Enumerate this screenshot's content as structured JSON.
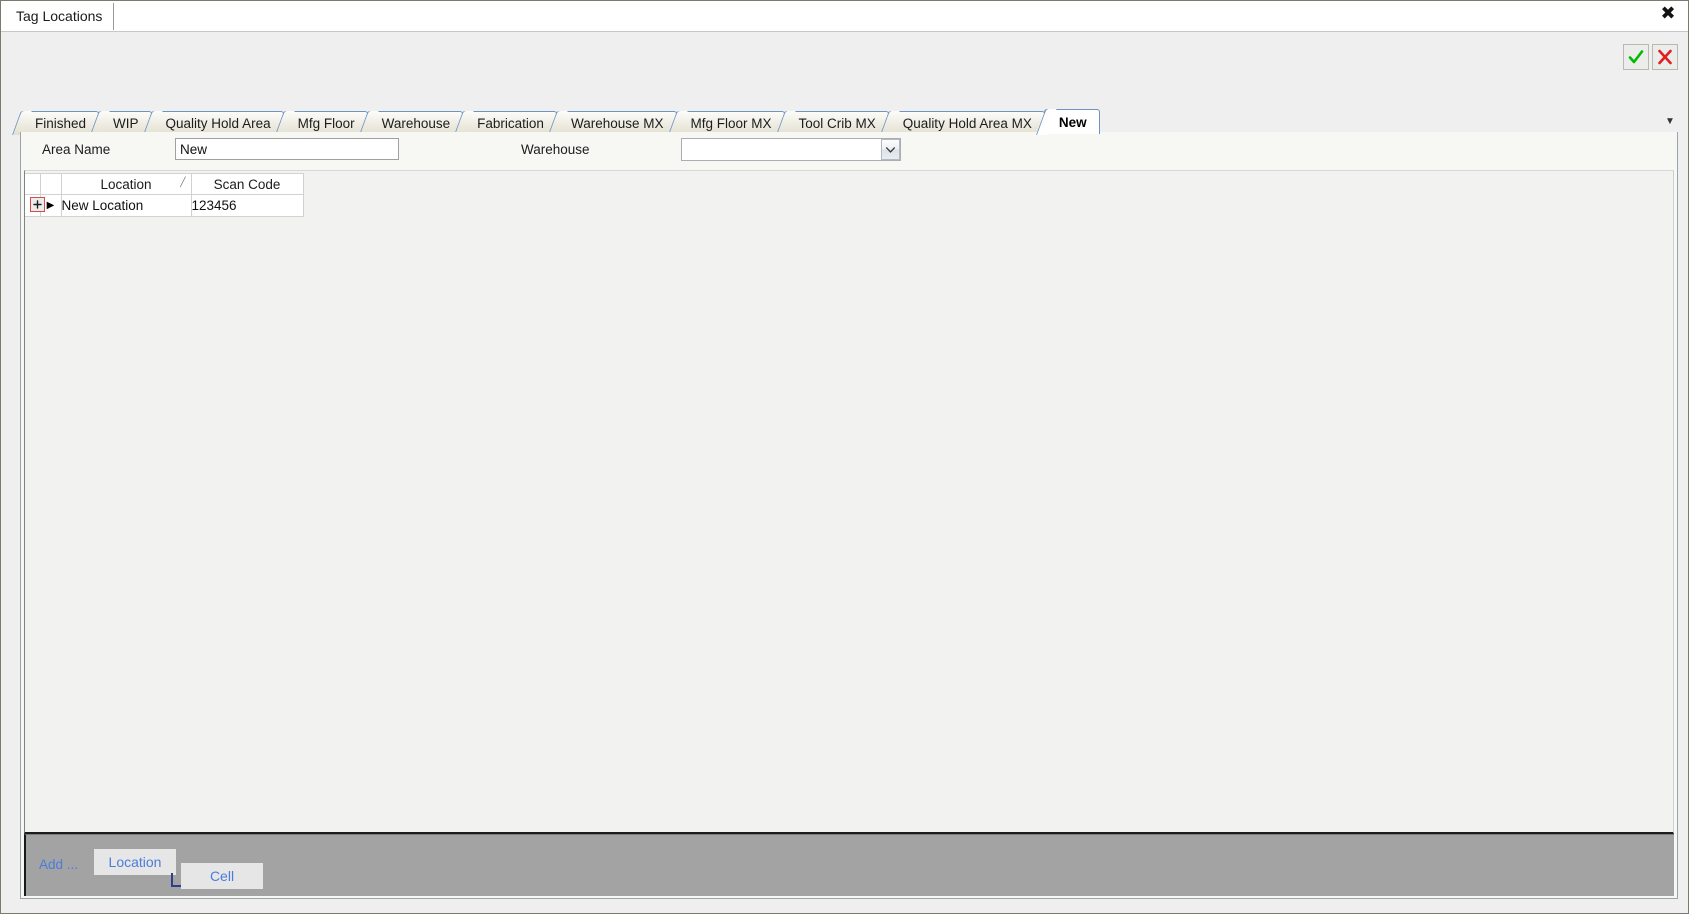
{
  "window": {
    "document_tab": "Tag Locations",
    "close_label": "✖"
  },
  "actions": {
    "confirm_name": "confirm-check",
    "cancel_name": "cancel-cross",
    "confirm_color": "#00bb00",
    "cancel_color": "#e02020"
  },
  "tabs": {
    "overflow_glyph": "▼",
    "items": [
      {
        "label": "Finished",
        "selected": false
      },
      {
        "label": "WIP",
        "selected": false
      },
      {
        "label": "Quality Hold Area",
        "selected": false
      },
      {
        "label": "Mfg Floor",
        "selected": false
      },
      {
        "label": "Warehouse",
        "selected": false
      },
      {
        "label": "Fabrication",
        "selected": false
      },
      {
        "label": "Warehouse MX",
        "selected": false
      },
      {
        "label": "Mfg Floor MX",
        "selected": false
      },
      {
        "label": "Tool Crib MX",
        "selected": false
      },
      {
        "label": "Quality Hold Area MX",
        "selected": false
      },
      {
        "label": "New",
        "selected": true
      }
    ]
  },
  "form": {
    "area_name_label": "Area Name",
    "area_name_value": "New",
    "area_name_placeholder": "",
    "warehouse_label": "Warehouse",
    "warehouse_value": "",
    "warehouse_chevron": "⌄"
  },
  "grid": {
    "expander_glyph": "+",
    "row_arrow_glyph": "▶",
    "sort_glyph": "╱",
    "columns": [
      {
        "key": "location",
        "label": "Location",
        "sorted": true
      },
      {
        "key": "scan_code",
        "label": "Scan Code",
        "sorted": false
      }
    ],
    "rows": [
      {
        "location": "New Location",
        "scan_code": "123456"
      }
    ]
  },
  "bottom_bar": {
    "add_label": "Add ...",
    "buttons": [
      {
        "label": "Location"
      },
      {
        "label": "Cell"
      }
    ]
  }
}
